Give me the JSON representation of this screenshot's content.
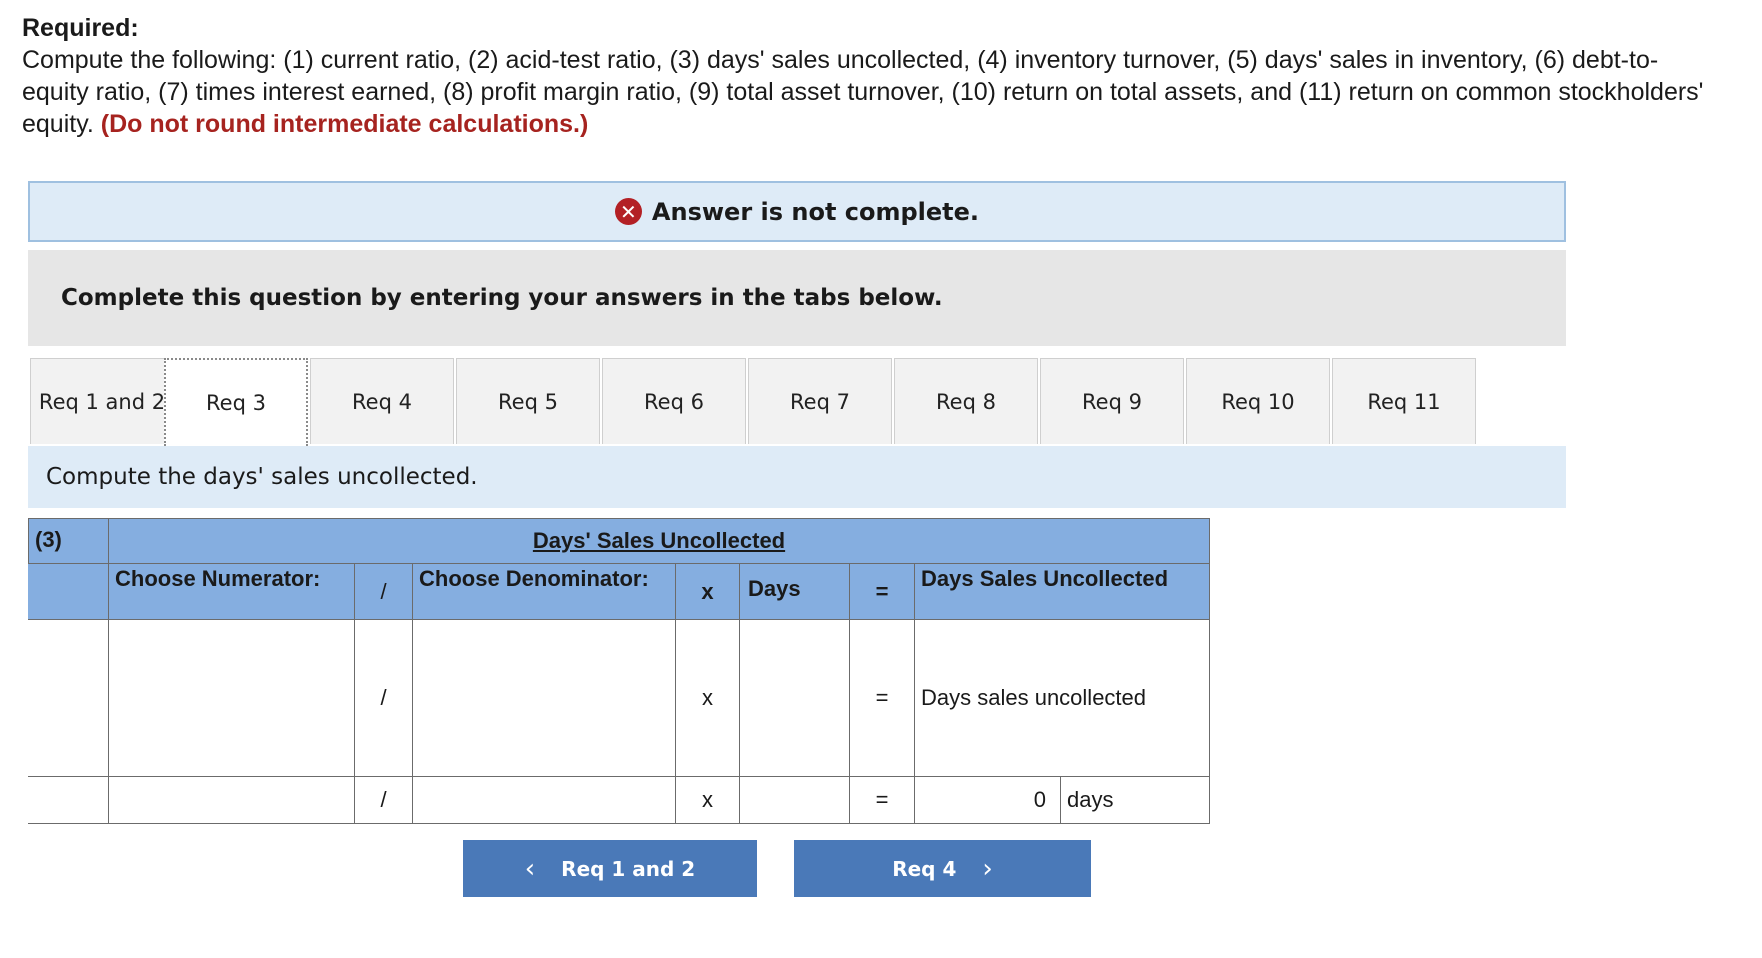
{
  "required": {
    "heading": "Required:",
    "text": "Compute the following: (1) current ratio, (2) acid-test ratio, (3) days' sales uncollected, (4) inventory turnover, (5) days' sales in inventory, (6) debt-to-equity ratio, (7) times interest earned, (8) profit margin ratio, (9) total asset turnover, (10) return on total assets, and (11) return on common stockholders' equity.",
    "note": "(Do not round intermediate calculations.)"
  },
  "banner": {
    "icon": "x-circle-icon",
    "text": "Answer is not complete."
  },
  "instruction": "Complete this question by entering your answers in the tabs below.",
  "tabs": [
    {
      "label": "Req 1 and 2"
    },
    {
      "label": "Req 3",
      "active": true
    },
    {
      "label": "Req 4"
    },
    {
      "label": "Req 5"
    },
    {
      "label": "Req 6"
    },
    {
      "label": "Req 7"
    },
    {
      "label": "Req 8"
    },
    {
      "label": "Req 9"
    },
    {
      "label": "Req 10"
    },
    {
      "label": "Req 11"
    }
  ],
  "subheader": "Compute the days' sales uncollected.",
  "table": {
    "row_label": "(3)",
    "title": "Days' Sales Uncollected",
    "headers": {
      "numerator": "Choose Numerator:",
      "div": "/",
      "denominator": "Choose Denominator:",
      "times": "x",
      "days": "Days",
      "equals": "=",
      "result": "Days Sales Uncollected"
    },
    "row1": {
      "div": "/",
      "times": "x",
      "equals": "=",
      "result_label": "Days sales uncollected"
    },
    "row2": {
      "div": "/",
      "times": "x",
      "equals": "=",
      "value": "0",
      "unit": "days"
    }
  },
  "nav": {
    "prev": "Req 1 and 2",
    "next": "Req 4"
  }
}
